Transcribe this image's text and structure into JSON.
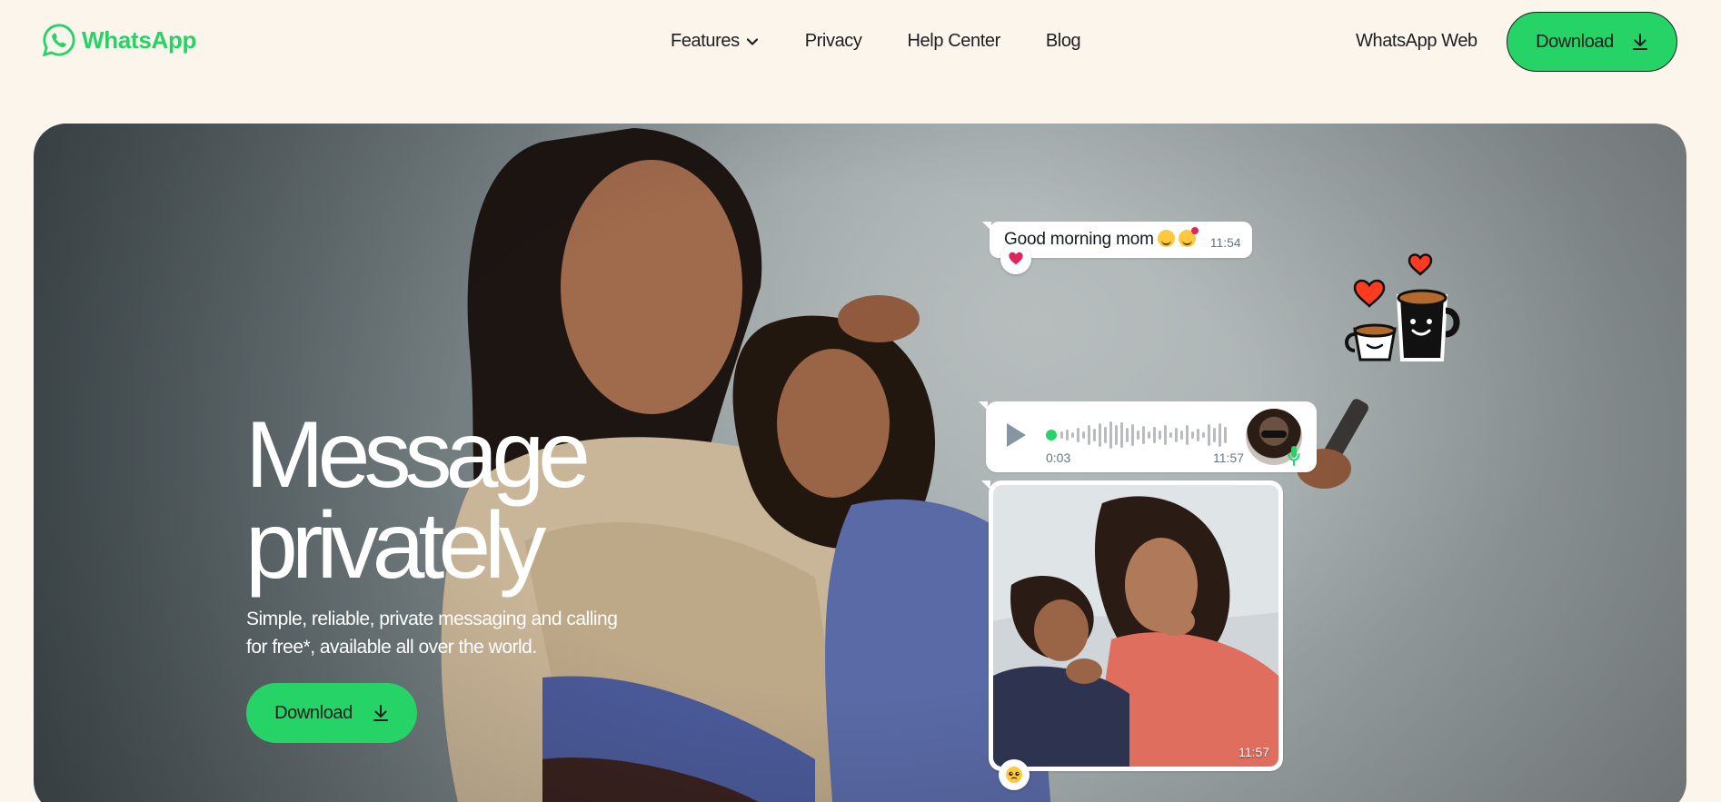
{
  "header": {
    "logo_text": "WhatsApp",
    "nav": {
      "features": "Features",
      "privacy": "Privacy",
      "help_center": "Help Center",
      "blog": "Blog"
    },
    "web_link": "WhatsApp Web",
    "download_label": "Download"
  },
  "hero": {
    "title_line1": "Message",
    "title_line2": "privately",
    "subtitle": "Simple, reliable, private messaging and calling for free*, available all over the world.",
    "download_label": "Download"
  },
  "chat": {
    "message_text": "Good morning mom",
    "message_time": "11:54",
    "voice_duration": "0:03",
    "voice_time": "11:57",
    "photo_time": "11:57"
  },
  "colors": {
    "brand_green": "#25d366",
    "page_background": "#fcf5eb",
    "text_dark": "#1c1e21"
  }
}
